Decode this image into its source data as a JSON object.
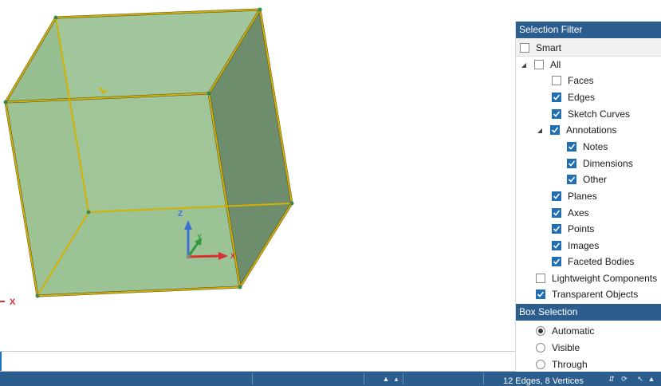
{
  "viewport": {
    "triad": {
      "z_label": "Z",
      "y_label": "Y",
      "x_label": "X"
    },
    "edge_triad": {
      "x_label": "X"
    },
    "colors": {
      "face_light": "#9dc496",
      "face_mid": "#8fb88a",
      "face_dark": "#6e8d6c",
      "edge": "#d4b100",
      "vertex": "#3a8a50"
    }
  },
  "selection_filter": {
    "title": "Selection Filter",
    "smart": {
      "label": "Smart",
      "checked": false
    },
    "all": {
      "label": "All",
      "checked": false
    },
    "items": {
      "faces": {
        "label": "Faces",
        "checked": false
      },
      "edges": {
        "label": "Edges",
        "checked": true
      },
      "sketch_curves": {
        "label": "Sketch Curves",
        "checked": true
      },
      "annotations": {
        "label": "Annotations",
        "checked": true
      },
      "notes": {
        "label": "Notes",
        "checked": true
      },
      "dimensions": {
        "label": "Dimensions",
        "checked": true
      },
      "other": {
        "label": "Other",
        "checked": true
      },
      "planes": {
        "label": "Planes",
        "checked": true
      },
      "axes": {
        "label": "Axes",
        "checked": true
      },
      "points": {
        "label": "Points",
        "checked": true
      },
      "images": {
        "label": "Images",
        "checked": true
      },
      "faceted_bodies": {
        "label": "Faceted Bodies",
        "checked": true
      },
      "lightweight_components": {
        "label": "Lightweight Components",
        "checked": false
      },
      "transparent_objects": {
        "label": "Transparent Objects",
        "checked": true
      }
    }
  },
  "box_selection": {
    "title": "Box Selection",
    "options": {
      "automatic": {
        "label": "Automatic",
        "selected": true
      },
      "visible": {
        "label": "Visible",
        "selected": false
      },
      "through": {
        "label": "Through",
        "selected": false
      }
    }
  },
  "status_bar": {
    "selection_info": "12 Edges, 8 Vertices"
  }
}
